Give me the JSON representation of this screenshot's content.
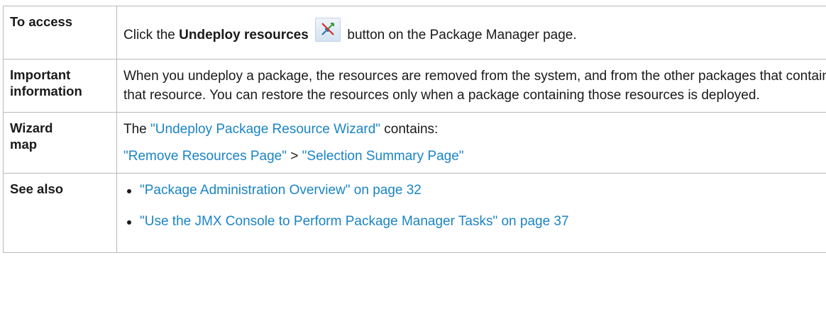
{
  "rows": {
    "access": {
      "header": "To access",
      "prefix": "Click the ",
      "bold": "Undeploy resources",
      "icon": "undeploy-icon",
      "suffix": " button on the Package Manager page."
    },
    "important": {
      "header_line1": "Important",
      "header_line2": "information",
      "text": "When you undeploy a package, the resources are removed from the system, and from the other packages that contain that resource. You can restore the resources only when a package containing those resources is deployed."
    },
    "wizard": {
      "header_line1": "Wizard",
      "header_line2": "map",
      "line1_prefix": "The ",
      "line1_link": "\"Undeploy Package Resource Wizard\"",
      "line1_suffix": " contains:",
      "step1": "\"Remove Resources Page\"",
      "separator": " > ",
      "step2": "\"Selection Summary Page\""
    },
    "see_also": {
      "header": "See also",
      "items": [
        "\"Package Administration Overview\" on page 32",
        "\"Use the JMX Console to Perform Package Manager Tasks\" on page 37"
      ]
    }
  },
  "colors": {
    "link": "#1b84c6",
    "border": "#b9b9b9",
    "text": "#1a1a1a"
  }
}
